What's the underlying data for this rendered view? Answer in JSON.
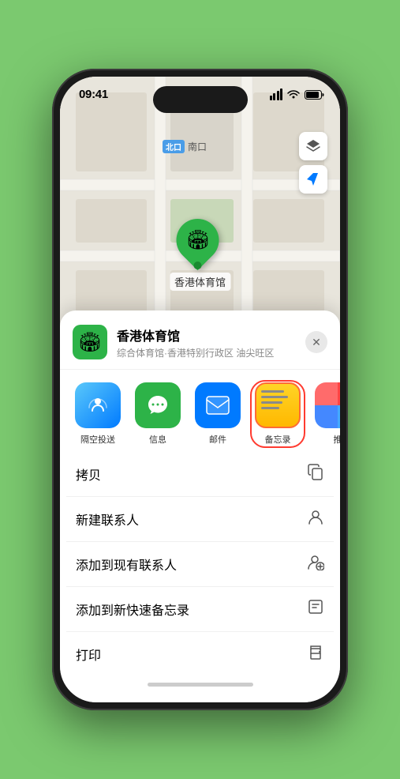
{
  "status": {
    "time": "09:41",
    "location_icon": "▶"
  },
  "map": {
    "north_badge": "北口",
    "north_label": "南口",
    "venue_pin_label": "香港体育馆"
  },
  "map_controls": {
    "layers_label": "map-layers",
    "location_label": "location-arrow"
  },
  "sheet": {
    "venue_name": "香港体育馆",
    "venue_subtitle": "综合体育馆·香港特别行政区 油尖旺区",
    "close_label": "✕"
  },
  "share_items": [
    {
      "id": "airdrop",
      "label": "隔空投送"
    },
    {
      "id": "messages",
      "label": "信息"
    },
    {
      "id": "mail",
      "label": "邮件"
    },
    {
      "id": "notes",
      "label": "备忘录"
    },
    {
      "id": "more",
      "label": "推"
    }
  ],
  "actions": [
    {
      "label": "拷贝",
      "icon": "copy"
    },
    {
      "label": "新建联系人",
      "icon": "person"
    },
    {
      "label": "添加到现有联系人",
      "icon": "person-add"
    },
    {
      "label": "添加到新快速备忘录",
      "icon": "note"
    },
    {
      "label": "打印",
      "icon": "print"
    }
  ]
}
